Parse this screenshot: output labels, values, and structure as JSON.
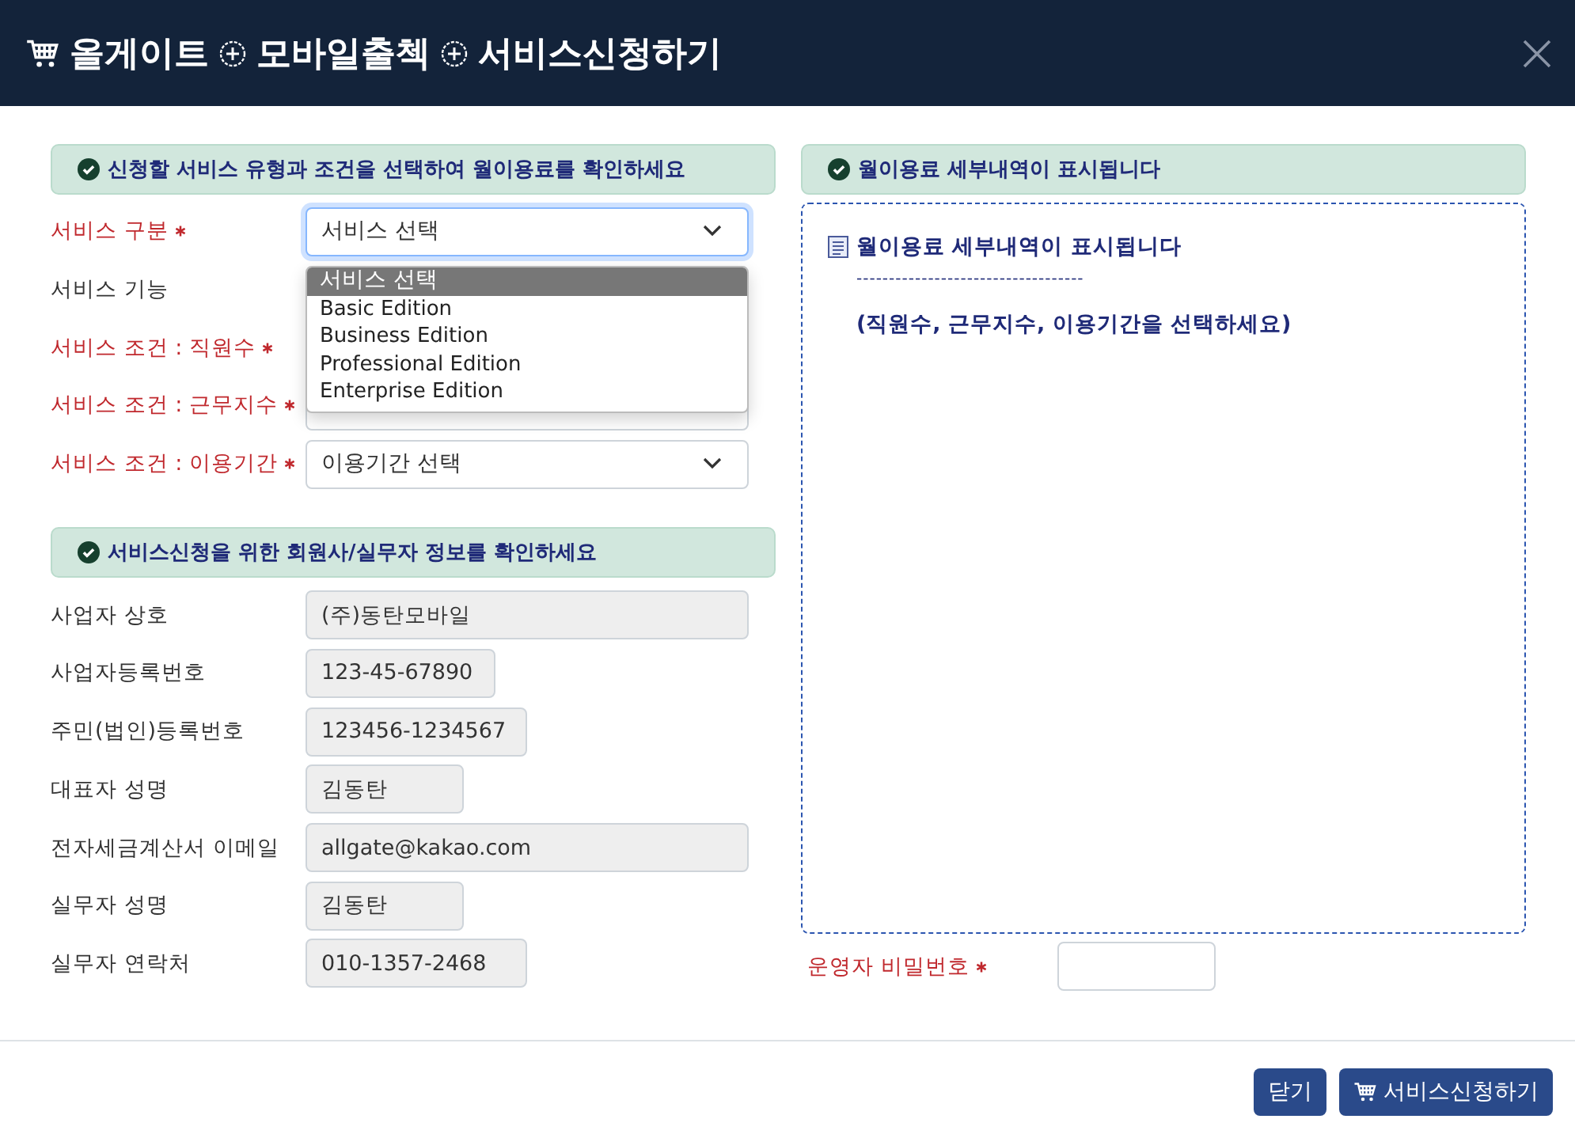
{
  "header": {
    "breadcrumb": [
      "올게이트",
      "모바일출첵",
      "서비스신청하기"
    ]
  },
  "service_section": {
    "title": "신청할 서비스 유형과 조건을 선택하여 월이용료를 확인하세요",
    "rows": [
      {
        "label": "서비스 구분",
        "required": true,
        "kind": "select",
        "value": "서비스 선택",
        "focused": true
      },
      {
        "label": "서비스 기능",
        "required": false,
        "kind": "none"
      },
      {
        "label": "서비스 조건 : 직원수",
        "required": true,
        "kind": "none"
      },
      {
        "label": "서비스 조건 : 근무지수",
        "required": true,
        "kind": "select"
      },
      {
        "label": "서비스 조건 : 이용기간",
        "required": true,
        "kind": "select",
        "value": "이용기간 선택",
        "focused": false
      }
    ],
    "dropdown": {
      "options": [
        {
          "label": "서비스 선택",
          "selected": true
        },
        {
          "label": "Basic Edition",
          "selected": false
        },
        {
          "label": "Business Edition",
          "selected": false
        },
        {
          "label": "Professional Edition",
          "selected": false
        },
        {
          "label": "Enterprise Edition",
          "selected": false
        }
      ]
    }
  },
  "member_section": {
    "title": "서비스신청을 위한 회원사/실무자 정보를 확인하세요",
    "rows": [
      {
        "label": "사업자 상호",
        "value": "(주)동탄모바일"
      },
      {
        "label": "사업자등록번호",
        "value": "123-45-67890"
      },
      {
        "label": "주민(법인)등록번호",
        "value": "123456-1234567"
      },
      {
        "label": "대표자 성명",
        "value": "김동탄"
      },
      {
        "label": "전자세금계산서 이메일",
        "value": "allgate@kakao.com"
      },
      {
        "label": "실무자 성명",
        "value": "김동탄"
      },
      {
        "label": "실무자 연락처",
        "value": "010-1357-2468"
      }
    ]
  },
  "fee_section": {
    "title": "월이용료 세부내역이 표시됩니다",
    "detail": {
      "heading": "월이용료 세부내역이 표시됩니다",
      "separator": "-----------------------------------",
      "hint": "(직원수, 근무지수, 이용기간을 선택하세요)"
    }
  },
  "password": {
    "label": "운영자 비밀번호",
    "required": true
  },
  "buttons": [
    {
      "label": "닫기",
      "kind": "plain"
    },
    {
      "label": "서비스신청하기",
      "kind": "cart"
    }
  ]
}
